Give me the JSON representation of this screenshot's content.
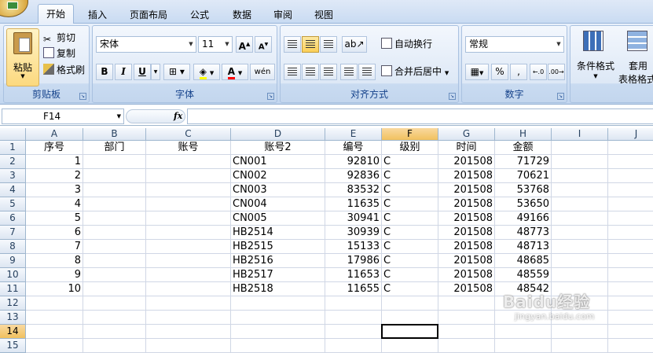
{
  "ribbon": {
    "tabs": [
      "开始",
      "插入",
      "页面布局",
      "公式",
      "数据",
      "审阅",
      "视图"
    ],
    "clipboard": {
      "label": "剪贴板",
      "paste": "粘贴",
      "cut": "剪切",
      "copy": "复制",
      "format_painter": "格式刷"
    },
    "font": {
      "label": "字体",
      "name": "宋体",
      "size": "11",
      "bold": "B",
      "italic": "I",
      "underline": "U",
      "wen": "wén"
    },
    "alignment": {
      "label": "对齐方式",
      "wrap": "自动换行",
      "merge": "合并后居中"
    },
    "number": {
      "label": "数字",
      "format": "常规",
      "percent": "%",
      "comma": ","
    },
    "styles": {
      "conditional": "条件格式",
      "table_format_1": "套用",
      "table_format_2": "表格格式"
    }
  },
  "formula_bar": {
    "name_box": "F14",
    "fx": "fx",
    "value": ""
  },
  "grid": {
    "columns": [
      "A",
      "B",
      "C",
      "D",
      "E",
      "F",
      "G",
      "H",
      "I",
      "J"
    ],
    "rows": [
      "1",
      "2",
      "3",
      "4",
      "5",
      "6",
      "7",
      "8",
      "9",
      "10",
      "11",
      "12",
      "13",
      "14",
      "15"
    ],
    "header": {
      "A": "序号",
      "B": "部门",
      "C": "账号",
      "D": "账号2",
      "E": "编号",
      "F": "级别",
      "G": "时间",
      "H": "金额"
    },
    "data": [
      {
        "A": "1",
        "D": "CN001",
        "E": "92810",
        "F": "C",
        "G": "201508",
        "H": "71729"
      },
      {
        "A": "2",
        "D": "CN002",
        "E": "92836",
        "F": "C",
        "G": "201508",
        "H": "70621"
      },
      {
        "A": "3",
        "D": "CN003",
        "E": "83532",
        "F": "C",
        "G": "201508",
        "H": "53768"
      },
      {
        "A": "4",
        "D": "CN004",
        "E": "11635",
        "F": "C",
        "G": "201508",
        "H": "53650"
      },
      {
        "A": "5",
        "D": "CN005",
        "E": "30941",
        "F": "C",
        "G": "201508",
        "H": "49166"
      },
      {
        "A": "6",
        "D": "HB2514",
        "E": "30939",
        "F": "C",
        "G": "201508",
        "H": "48773"
      },
      {
        "A": "7",
        "D": "HB2515",
        "E": "15133",
        "F": "C",
        "G": "201508",
        "H": "48713"
      },
      {
        "A": "8",
        "D": "HB2516",
        "E": "17986",
        "F": "C",
        "G": "201508",
        "H": "48685"
      },
      {
        "A": "9",
        "D": "HB2517",
        "E": "11653",
        "F": "C",
        "G": "201508",
        "H": "48559"
      },
      {
        "A": "10",
        "D": "HB2518",
        "E": "11655",
        "F": "C",
        "G": "201508",
        "H": "48542"
      }
    ],
    "selected_column": "F",
    "selected_row": "14"
  },
  "watermark": {
    "brand": "Baidu经验",
    "sub": "jingyan.baidu.com"
  }
}
